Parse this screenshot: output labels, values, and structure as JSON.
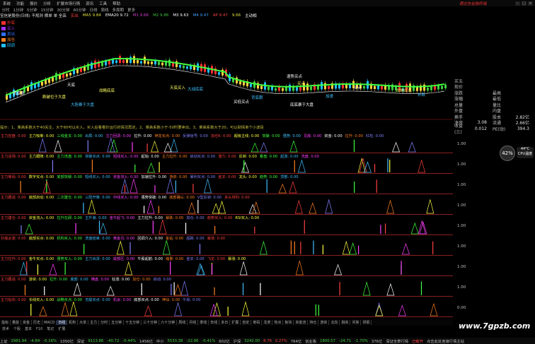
{
  "menubar": {
    "items": [
      "系统",
      "功能",
      "报价",
      "分析",
      "扩展市场行情",
      "资讯",
      "工具",
      "帮助"
    ],
    "title": "通达信金融终端"
  },
  "periodbar": {
    "items": [
      "分时",
      "1分钟",
      "5分钟",
      "15分钟",
      "30分钟",
      "60分钟",
      "日线",
      "周线",
      "多周期",
      "更多"
    ]
  },
  "infobar": {
    "prefix": "宝信是股份(日线) 不规则 横单 单 全高",
    "values": [
      "MA5 9.84",
      "EMA20 9.72",
      "M1 9.66",
      "M2 9.86",
      "M3 9.63",
      "M4 9.47",
      "AP 9.47",
      "9.66",
      "主动相"
    ],
    "colors": [
      "#e0e040",
      "#ffffff",
      "#d040d0",
      "#40c040",
      "#ffffff",
      "#40a0ff",
      "#ff4040",
      "#e0e040",
      "#ffffff"
    ],
    "buy_tag": "买出"
  },
  "legend": [
    {
      "label": "抄底",
      "color": "#ff3030"
    },
    {
      "label": "买入",
      "color": "#a030ff"
    },
    {
      "label": "卖出",
      "color": "#3070ff"
    },
    {
      "label": "加仓",
      "color": "#ff8020"
    },
    {
      "label": "回调",
      "color": "#20c0ff"
    }
  ],
  "annotations": [
    "背底跟",
    "战略底底",
    "大战底底",
    "天底",
    "天底买入",
    "背底跟",
    "退势买点",
    "买点",
    "加速",
    "买点",
    "战略底底",
    "补跌",
    "买低买点",
    "跌破位于大盘",
    "大胆暴于大盘",
    "底底暴于大盘"
  ],
  "tipline": "提示：1、乘高系数大于40关注，大于60可以买入，买入后看看价运行的情况再定。2、乘高系数小于-50时要卖出，3、乘高系数大于20，可以耐情单个小波段",
  "quote_panel": {
    "header": "买五",
    "rows": [
      {
        "l": "现价",
        "v": "",
        "l2": "",
        "v2": ""
      },
      {
        "l": "涨跌",
        "v": "",
        "l2": "最高",
        "v2": ""
      },
      {
        "l": "涨幅",
        "v": "",
        "l2": "最低",
        "v2": ""
      },
      {
        "l": "总量",
        "v": "",
        "l2": "量比",
        "v2": ""
      },
      {
        "l": "外盘",
        "v": "",
        "l2": "内盘",
        "v2": ""
      },
      {
        "l": "换手",
        "v": "",
        "l2": "股本",
        "v2": "2.82亿"
      },
      {
        "l": "净资",
        "v": "3.08",
        "l2": "流通",
        "v2": "2.66亿"
      },
      {
        "l": "收益(三)",
        "v": "0.012",
        "l2": "PE(动)",
        "v2": "394.3"
      }
    ]
  },
  "gauge": {
    "percent": "42%",
    "temp": "44°C",
    "label": "CPU温度"
  },
  "panels": [
    {
      "labels": [
        "主力控盘: 0.00",
        "主力吸筹: 0.00",
        "三线金叉: 0.00",
        "出局: 0.00",
        "主力回调: 0.00",
        "拉升: 0.00",
        "神龙买点: 0.00",
        "反弹信号: 0.00",
        "加仓K: 0.00",
        "超级主线: 0.00",
        "突破: 0.00",
        "强势: 0.00",
        "见底: 0.00",
        "资金: 0.00",
        "拉升: 0.00",
        "红柱: 0.00"
      ],
      "axis": "1.00"
    },
    {
      "labels": [
        "主力进场: 0.00",
        "主力跟随: 0.00",
        "主力洗盘: 0.00",
        "突破买点: 0.00",
        "短线买入: 0.00",
        "起始: 0.00",
        "主力拉升: 0.00",
        "启动买点: 0.00",
        "潜力: 0.00",
        "反转: 0.00",
        "看盘: 0.00",
        "起涨: 0.00",
        "洗盘: 0.00"
      ],
      "axis": "1.00"
    },
    {
      "labels": [
        "主力筹码: 0.00",
        "数字买点: 0.00",
        "底部突破: 0.00",
        "短线买入: 0.00",
        "资金流入: 0.00",
        "加速拉升: 0.00",
        "游资: 0.00",
        "暴利买点: 0.00",
        "金叉: 0.00",
        "龙头: 0.00",
        "趋势: 0.00",
        "顶部: 0.00"
      ],
      "axis": "1.00"
    },
    {
      "labels": [
        "主力跟进: 0.00",
        "底部启动: 0.00",
        "二次建仓: 0.00",
        "三阳开泰: 0.00",
        "中线买入: 0.00",
        "强势突破: 0.00",
        "底部确认: 0.00",
        "V型反转: 0.00",
        "多头排列: 0.00"
      ],
      "axis": "1.00"
    },
    {
      "labels": [
        "主力建仓: 0.00",
        "资金流入: 0.00",
        "拉升在即: 0.00",
        "主升浪: 0.00",
        "金牛起飞: 0.00",
        "主力拉升: 0.00",
        "暴跌: 0.00",
        "加仓: 0.00",
        "趋势买入: 0.00",
        "RSI买入: 0.00"
      ],
      "axis": "1.00"
    },
    {
      "labels": [
        "抄底必涨: 0.00",
        "底部买点: 0.00",
        "机构买入: 0.00",
        "洗盘结束: 0.00",
        "黄金坑: 0.00",
        "回调介入: 0.00",
        "金钻: 0.00",
        "超跌: 0.00",
        "暴涨: 0.00"
      ],
      "axis": "1.00"
    },
    {
      "labels": [
        "主力拉升: 0.00",
        "金牛买点: 0.00",
        "强势买入: 0.00",
        "主力出货: 0.00",
        "底部区: 0.00",
        "牛股起航: 0.00",
        "缩量: 0.00",
        "金叉: 0.00",
        "飞龙: 0.00",
        "暴涨: 0.00"
      ],
      "axis": "1.00"
    },
    {
      "labels": [
        "主力跟进: 0.00",
        "游资: 0.00",
        "拉升: 0.00",
        "底部: 0.00",
        "横盘: 0.00",
        "狂涨: 0.00",
        "加仓: 0.00",
        "启动: 0.00"
      ],
      "axis": "1.00"
    },
    {
      "labels": [
        "主力钻石: 0.00",
        "长线买入: 0.00",
        "战略买点: 0.00",
        "无敌买点: 0.00",
        "机会: 0.00",
        "底部买点: 0.00",
        "神仙: 0.00",
        "牛股: 0.00"
      ],
      "axis": "0.00"
    }
  ],
  "tabs": [
    "指标",
    "量能",
    "资金",
    "历史",
    "MACD",
    "日线",
    "机构",
    "大单",
    "主力",
    "分时",
    "五分钟",
    "十五分钟",
    "三十分钟",
    "六十分钟",
    "周线",
    "月线",
    "季线",
    "年线",
    "多日",
    "扩展",
    "自定",
    "筹码",
    "龙虎",
    "热点",
    "板块",
    "资金流",
    "持仓",
    "游资",
    "北向",
    "融资",
    "问答",
    "研报"
  ],
  "tabs2": [
    "技术",
    "个股",
    "基本",
    "F10",
    "笔记",
    "扩展"
  ],
  "statusbar": [
    {
      "t": "上证",
      "c": "#c0c0c0"
    },
    {
      "t": "2981.94",
      "c": "#40d040"
    },
    {
      "t": "-4.84",
      "c": "#40d040"
    },
    {
      "t": "-0.16%",
      "c": "#40d040"
    },
    {
      "t": "1050亿",
      "c": "#c0c0c0"
    },
    {
      "t": "深证",
      "c": "#c0c0c0"
    },
    {
      "t": "9113.86",
      "c": "#40d040"
    },
    {
      "t": "-40.72",
      "c": "#40d040"
    },
    {
      "t": "-0.44%",
      "c": "#40d040"
    },
    {
      "t": "1456亿",
      "c": "#c0c0c0"
    },
    {
      "t": "中小",
      "c": "#c0c0c0"
    },
    {
      "t": "5533.38",
      "c": "#40d040"
    },
    {
      "t": "-22.86",
      "c": "#40d040"
    },
    {
      "t": "-0.41%",
      "c": "#40d040"
    },
    {
      "t": "602亿",
      "c": "#c0c0c0"
    },
    {
      "t": "沪深",
      "c": "#c0c0c0"
    },
    {
      "t": "3242.00",
      "c": "#40d040"
    },
    {
      "t": "8.76",
      "c": "#ff4040"
    },
    {
      "t": "0.27%",
      "c": "#ff4040"
    },
    {
      "t": "764亿",
      "c": "#c0c0c0"
    },
    {
      "t": "创业板",
      "c": "#c0c0c0"
    },
    {
      "t": "1800.57",
      "c": "#40d040"
    },
    {
      "t": "-24.71",
      "c": "#40d040"
    },
    {
      "t": "-1.70%",
      "c": "#40d040"
    },
    {
      "t": "376亿",
      "c": "#c0c0c0"
    },
    {
      "t": "深证全景行情",
      "c": "#c0c0c0"
    },
    {
      "t": "已断开",
      "c": "#ff4040"
    },
    {
      "t": "点击此处连接行情主站",
      "c": "#c0c0c0"
    }
  ],
  "watermark": "www.7gpzb.com"
}
